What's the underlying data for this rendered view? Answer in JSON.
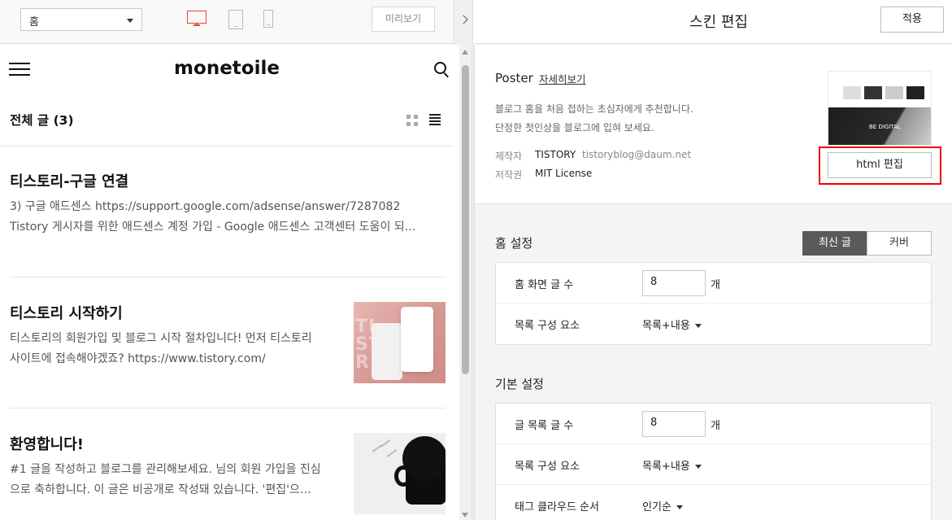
{
  "topbar": {
    "page_select": "홈",
    "preview_label": "미리보기"
  },
  "blog": {
    "title": "monetoile",
    "section_title": "전체 글 (3)",
    "posts": [
      {
        "title": "티스토리-구글 연결",
        "excerpt_line1": "3) 구글 애드센스 https://support.google.com/adsense/answer/7287082",
        "excerpt_line2": "Tistory 게시자를 위한 애드센스 계정 가입 - Google 애드센스 고객센터 도움이 되…"
      },
      {
        "title": "티스토리 시작하기",
        "excerpt_line1": "티스토리의 회원가입 및 블로그 시작 절차입니다! 먼저 티스토리",
        "excerpt_line2": "사이트에 접속해야겠죠? https://www.tistory.com/"
      },
      {
        "title": "환영합니다!",
        "excerpt_line1": "#1 글을 작성하고 블로그를 관리해보세요. 님의 회원 가입을 진심",
        "excerpt_line2": "으로 축하합니다. 이 글은 비공개로 작성돼 있습니다. '편집'으…"
      }
    ]
  },
  "editor": {
    "title": "스킨 편집",
    "apply_label": "적용",
    "skin": {
      "name": "Poster",
      "detail_link": "자세히보기",
      "desc_line1": "블로그 홈을 처음 접하는 초심자에게 추천합니다.",
      "desc_line2": "단정한 첫인상을 블로그에 입혀 보세요.",
      "maker_key": "제작자",
      "maker_val": "TISTORY",
      "maker_email": "tistoryblog@daum.net",
      "license_key": "저작권",
      "license_val": "MIT License",
      "thumb_text": "BE DIGITAL",
      "html_edit_label": "html 편집"
    },
    "home_settings": {
      "title": "홈 설정",
      "tabs": [
        "최신 글",
        "커버"
      ],
      "rows": [
        {
          "label": "홈 화면 글 수",
          "value": "8",
          "unit": "개"
        },
        {
          "label": "목록 구성 요소",
          "value": "목록+내용"
        }
      ]
    },
    "basic_settings": {
      "title": "기본 설정",
      "rows": [
        {
          "label": "글 목록 글 수",
          "value": "8",
          "unit": "개"
        },
        {
          "label": "목록 구성 요소",
          "value": "목록+내용"
        },
        {
          "label": "태그 클라우드 순서",
          "value": "인기순"
        }
      ]
    }
  },
  "colors": {
    "accent_red": "#e8452f",
    "highlight_red": "#ee0000",
    "active_tab": "#5a5a5a"
  }
}
